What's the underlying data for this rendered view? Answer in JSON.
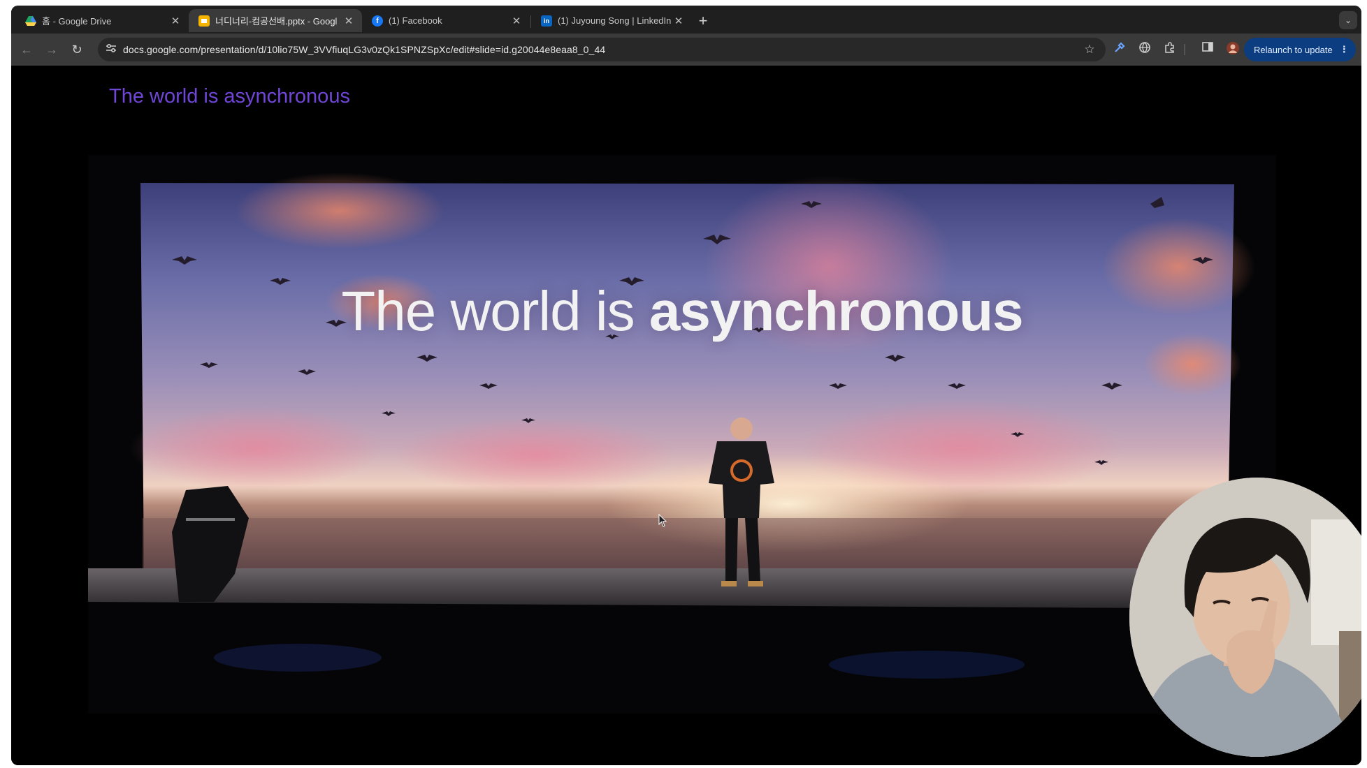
{
  "tabs": [
    {
      "title": "홈 - Google Drive",
      "icon": "google-drive-icon",
      "active": false
    },
    {
      "title": "너디너리-컴공선배.pptx - Googl",
      "icon": "google-slides-icon",
      "active": true
    },
    {
      "title": "(1) Facebook",
      "icon": "facebook-icon",
      "active": false
    },
    {
      "title": "(1) Juyoung Song | LinkedIn",
      "icon": "linkedin-icon",
      "active": false
    }
  ],
  "toolbar": {
    "url": "docs.google.com/presentation/d/10lio75W_3VVfiuqLG3v0zQk1SPNZSpXc/edit#slide=id.g20044e8eaa8_0_44",
    "relaunch_label": "Relaunch to update"
  },
  "slide": {
    "title": "The world is asynchronous"
  },
  "video": {
    "caption_light": "The world is ",
    "caption_bold": "asynchronous"
  },
  "colors": {
    "slide_title": "#7046d6",
    "relaunch_bg": "#0b3d80",
    "tab_strip": "#1f1f1f",
    "toolbar": "#3a3a3a"
  }
}
